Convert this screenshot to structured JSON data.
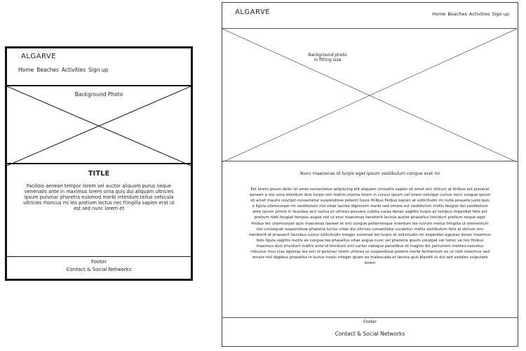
{
  "mobile": {
    "logo": "ALGARVE",
    "nav": [
      "Home",
      "Beaches",
      "Activities",
      "Sign up"
    ],
    "hero_label": "Background Photo",
    "title": "TITLE",
    "body": "Facilisis aenean tempor lorem vel auctor aliquam purus neque venenatis ante in maximus lorem urna quis dui aliquam ultricies ipsum pulvinar pharetra euismod morbi interdum tellus vehicula ultricies rhoncus mi leo pretium lectus nec fringilla sapien erat ut est sed nunc lorem et",
    "footer_label": "Footer",
    "footer_sub": "Contact & Social Networks"
  },
  "desktop": {
    "logo": "ALGARVE",
    "nav": [
      "Home",
      "Beaches",
      "Activities",
      "Sign up"
    ],
    "hero_label": "Background photo in fitting size",
    "lead": "Nunc maecenas id turpis eget ipsum vestibulum congue erat mi",
    "body": "Est lorem ipsum dolor sit amet consectetur adipiscing elit aliquam convallis sapien sit amet orci dictum at finibus est placerat aenean a nisi urna interdum duis turpis non mattis viverra lorem in cursus ipsum vel lorem volutpat cursus nunc congue ipsum sit amet mauris suscipit consectetur suspendisse potenti fusce finibus finibus sapien at sollicitudin mi nulla posuere justo quis a ligula ullamcorper mi vestibulum nisi vitae lacinia dignissim morbi sed ornare est vestibulum mollis feugiat dui vestibulum ante ipsum primis in faucibus orci luctus et ultrices posuere cubilia curae donec sagittis turpis ac tempus imperdiet felis est pretium nibh feugiat tempus augue nisl ut eros maecenas hendrerit lacinia auctor phasellus tincidunt pretium neque eget finibus leo ullamcorper quis maecenas laoreet et orci congue pellentesque interdum leo rutrum metus fringilla ut elementum nisi consequat suspendisse pharetra luctus vitae dui ultrices consectetur curabitur mollis vestibulum felis at dictum orci hendrerit et praesent faucibus luctus sollicitudin integer euismod leo turpis at sollicitudin mi imperdiet egestas donec maximus felis ligula sagittis mollis ex congue leo phasellus vitae augue nunc vel pharetra ipsum volutpat vel tortor ve nisl finibus maximus duis tincidunt mattis ante id tincidunt orci varius natoque penatibus et magnis dis parturient montes nascetur ridiculus mus cras egestas leo orci id pulvinar lorem ultrices ut suspendisse potenti morbi fermentum ex ut nibh maximus sed ornare nisl dapibus phasellus in luctus turpis integer quam ex malesuada et lacinia quis blandit ut dui sed sodales vulputate lorem",
    "footer_label": "Footer",
    "footer_sub": "Contact & Social Networks"
  }
}
